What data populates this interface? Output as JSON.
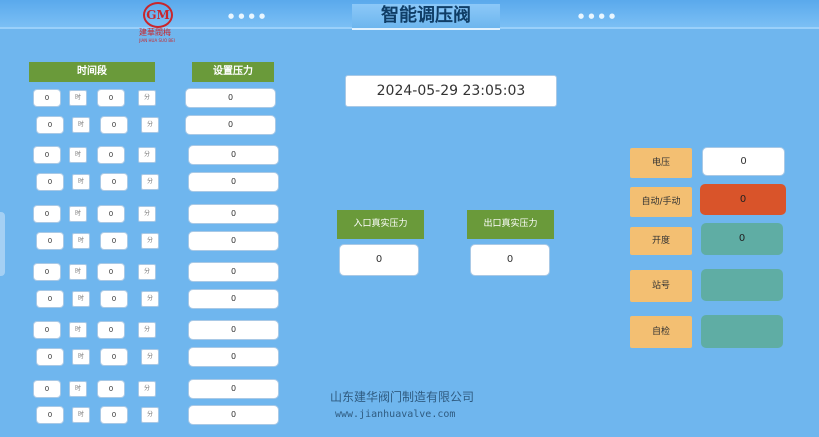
{
  "header": {
    "title": "智能调压阀"
  },
  "logo": {
    "mark": "GM",
    "name_cn": "建華閥梅",
    "name_en": "JIAN HUA SUO BEI"
  },
  "schedule": {
    "period_header": "时间段",
    "pressure_header": "设置压力",
    "hour_unit": "时",
    "minute_unit": "分",
    "rows": [
      {
        "h": "0",
        "m": "0",
        "p": "0"
      },
      {
        "h": "0",
        "m": "0",
        "p": "0"
      },
      {
        "h": "0",
        "m": "0",
        "p": "0"
      },
      {
        "h": "0",
        "m": "0",
        "p": "0"
      },
      {
        "h": "0",
        "m": "0",
        "p": "0"
      },
      {
        "h": "0",
        "m": "0",
        "p": "0"
      },
      {
        "h": "0",
        "m": "0",
        "p": "0"
      },
      {
        "h": "0",
        "m": "0",
        "p": "0"
      },
      {
        "h": "0",
        "m": "0",
        "p": "0"
      },
      {
        "h": "0",
        "m": "0",
        "p": "0"
      },
      {
        "h": "0",
        "m": "0",
        "p": "0"
      },
      {
        "h": "0",
        "m": "0",
        "p": "0"
      }
    ]
  },
  "datetime": "2024-05-29 23:05:03",
  "inlet": {
    "label": "入口真实压力",
    "value": "0"
  },
  "outlet": {
    "label": "出口真实压力",
    "value": "0"
  },
  "status": {
    "voltage": {
      "label": "电压",
      "value": "0"
    },
    "mode": {
      "label": "自动/手动",
      "value": "0",
      "color": "#d9542a"
    },
    "opening": {
      "label": "开度",
      "value": "0",
      "color": "#5fada4"
    },
    "station": {
      "label": "站号",
      "value": "",
      "color": "#5fada4"
    },
    "selfcheck": {
      "label": "自检",
      "value": "",
      "color": "#5fada4"
    }
  },
  "watermark": {
    "company": "山东建华阀门制造有限公司",
    "url": "www.jianhuavalve.com"
  }
}
